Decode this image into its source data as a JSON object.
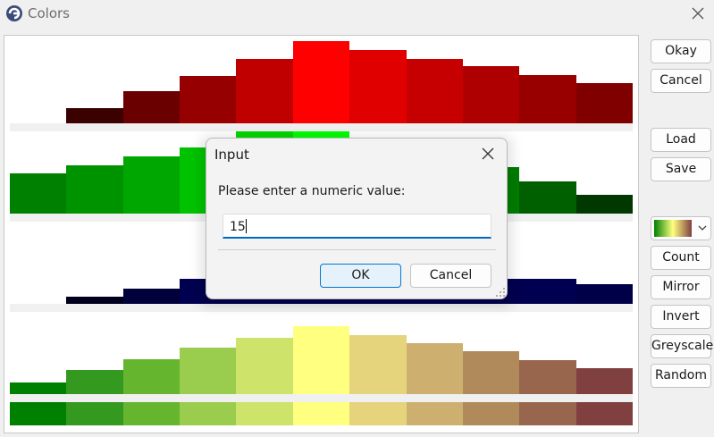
{
  "window": {
    "title": "Colors",
    "icon": "app-logo-icon",
    "close_icon": "close-icon"
  },
  "strips": [
    {
      "name": "red-channel",
      "kind": "histogram",
      "levels": [
        0,
        0.19,
        0.39,
        0.58,
        0.78,
        1.0,
        0.89,
        0.78,
        0.7,
        0.59,
        0.49
      ],
      "colors": [
        "#000000",
        "#3b0000",
        "#6b0000",
        "#970000",
        "#c00000",
        "#ff0000",
        "#e00000",
        "#c60000",
        "#ae0000",
        "#980000",
        "#800000"
      ]
    },
    {
      "name": "green-channel",
      "kind": "histogram",
      "levels": [
        0.49,
        0.59,
        0.7,
        0.8,
        1.0,
        1.0,
        0.9,
        0.78,
        0.56,
        0.39,
        0.23
      ],
      "colors": [
        "#008000",
        "#009300",
        "#00a700",
        "#00c200",
        "#00d800",
        "#00ff00",
        "#00d000",
        "#009800",
        "#007c00",
        "#006000",
        "#003800"
      ]
    },
    {
      "name": "blue-channel",
      "kind": "histogram",
      "levels": [
        0,
        0.09,
        0.19,
        0.3,
        0.3,
        0.3,
        0.3,
        0.3,
        0.3,
        0.3,
        0.24
      ],
      "colors": [
        "#000000",
        "#00001e",
        "#00003a",
        "#000050",
        "#000050",
        "#000050",
        "#000050",
        "#000050",
        "#000050",
        "#000050",
        "#000048"
      ]
    },
    {
      "name": "combined-colors",
      "kind": "histogram",
      "levels": [
        0.14,
        0.29,
        0.42,
        0.56,
        0.69,
        0.83,
        0.72,
        0.62,
        0.52,
        0.41,
        0.31
      ],
      "colors": [
        "#008000",
        "#339a1f",
        "#66b52f",
        "#9acd4d",
        "#cde36a",
        "#ffff80",
        "#e6d47c",
        "#cdb070",
        "#b08a5a",
        "#98654d",
        "#804040"
      ]
    },
    {
      "name": "color-swatches",
      "kind": "swatch",
      "colors": [
        "#008000",
        "#339a1f",
        "#66b52f",
        "#9acd4d",
        "#cde36a",
        "#ffff80",
        "#e6d47c",
        "#cdb070",
        "#b08a5a",
        "#98654d",
        "#804040"
      ]
    }
  ],
  "buttons": {
    "okay": "Okay",
    "cancel": "Cancel",
    "load": "Load",
    "save": "Save",
    "count": "Count",
    "mirror": "Mirror",
    "invert": "Invert",
    "greyscale": "Greyscale",
    "random": "Random"
  },
  "gradient_select": {
    "selected_colors": [
      "#008000",
      "#ffff80",
      "#804040"
    ],
    "icon": "chevron-down-icon"
  },
  "dialog": {
    "title": "Input",
    "prompt": "Please enter a numeric value:",
    "value": "15",
    "ok_label": "OK",
    "cancel_label": "Cancel",
    "close_icon": "close-icon",
    "accent": "#0067c0"
  }
}
